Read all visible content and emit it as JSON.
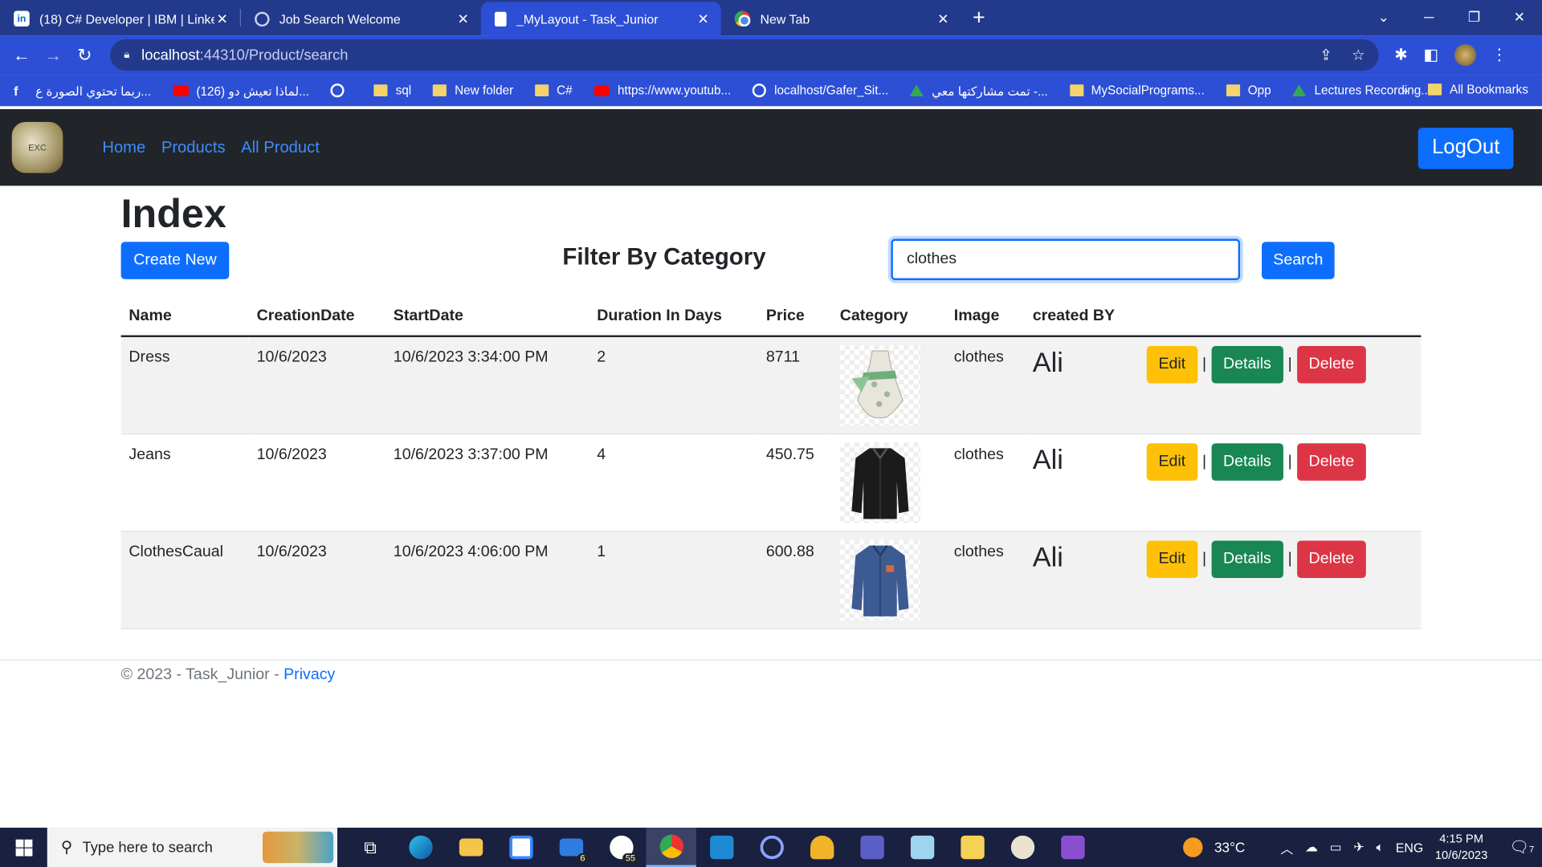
{
  "browser": {
    "tabs": [
      {
        "title": "(18) C# Developer | IBM | LinkedIn",
        "icon": "linkedin-icon",
        "active": false
      },
      {
        "title": "Job Search Welcome",
        "icon": "globe-icon",
        "active": false
      },
      {
        "title": "_MyLayout - Task_Junior",
        "icon": "document-icon",
        "active": true
      },
      {
        "title": "New Tab",
        "icon": "chrome-icon",
        "active": false
      }
    ],
    "url_host": "localhost",
    "url_rest": ":44310/Product/search",
    "bookmarks": [
      "ربما تحتوي الصورة ع...",
      "(126) لماذا تعيش دو...",
      "sql",
      "New folder",
      "C#",
      "https://www.youtub...",
      "localhost/Gafer_Sit...",
      "تمت مشاركتها معي -...",
      "MySocialPrograms...",
      "Opp",
      "Lectures Recording..."
    ],
    "bookmark_icons": [
      "facebook-icon",
      "youtube-icon",
      "globe-icon",
      "folder-icon",
      "folder-icon",
      "folder-icon",
      "youtube-icon",
      "globe-icon",
      "drive-icon",
      "folder-icon",
      "folder-icon",
      "drive-icon"
    ],
    "bookmarks_more": "»",
    "all_bookmarks": "All Bookmarks"
  },
  "app": {
    "nav": [
      "Home",
      "Products",
      "All Product"
    ],
    "logout": "LogOut",
    "page_title": "Index",
    "create_new": "Create New",
    "filter_label": "Filter By Category",
    "search_value": "clothes",
    "search_button": "Search",
    "columns": [
      "Name",
      "CreationDate",
      "StartDate",
      "Duration In Days",
      "Price",
      "Category",
      "Image",
      "created BY"
    ],
    "rows": [
      {
        "name": "Dress",
        "creation": "10/6/2023",
        "start": "10/6/2023 3:34:00 PM",
        "duration": "2",
        "price": "8711",
        "category": "clothes",
        "creator": "Ali",
        "image": "dress-image"
      },
      {
        "name": "Jeans",
        "creation": "10/6/2023",
        "start": "10/6/2023 3:37:00 PM",
        "duration": "4",
        "price": "450.75",
        "category": "clothes",
        "creator": "Ali",
        "image": "black-shirt-image"
      },
      {
        "name": "ClothesCaual",
        "creation": "10/6/2023",
        "start": "10/6/2023 4:06:00 PM",
        "duration": "1",
        "price": "600.88",
        "category": "clothes",
        "creator": "Ali",
        "image": "blue-shirt-image"
      }
    ],
    "actions": {
      "edit": "Edit",
      "details": "Details",
      "delete": "Delete",
      "sep": "|"
    },
    "footer_text": "© 2023 - Task_Junior - ",
    "footer_link": "Privacy"
  },
  "taskbar": {
    "search_placeholder": "Type here to search",
    "apps": [
      "task-view-icon",
      "edge-icon",
      "file-explorer-icon",
      "store-icon",
      "mail-icon",
      "whatsapp-icon",
      "chrome-icon",
      "vscode-icon",
      "app-icon",
      "award-icon",
      "teams-icon",
      "notepad-icon",
      "paint-icon",
      "palette-icon",
      "visual-studio-icon"
    ],
    "mail_badge": "6",
    "whatsapp_badge": "55",
    "temperature": "33°C",
    "language": "ENG",
    "time": "4:15 PM",
    "date": "10/6/2023",
    "notifications": "7"
  },
  "colors": {
    "primary": "#0d6efd",
    "warning": "#ffc107",
    "success": "#198754",
    "danger": "#dc3545",
    "navbar": "#212529",
    "browser": "#2c4fd6"
  }
}
